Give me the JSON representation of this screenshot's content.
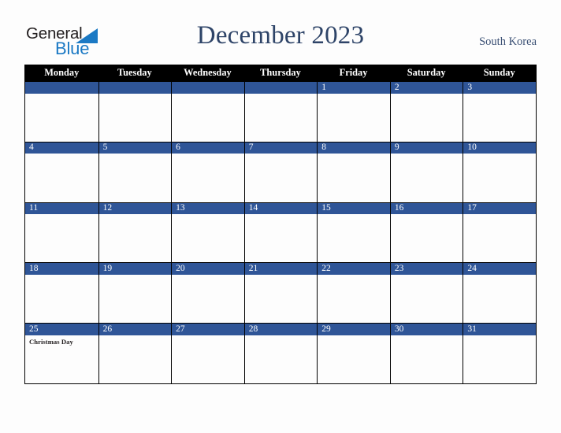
{
  "brand": {
    "word_primary": "General",
    "word_secondary": "Blue",
    "primary_color": "#231f20",
    "secondary_color": "#1b79c4"
  },
  "header": {
    "title": "December 2023",
    "region": "South Korea",
    "title_color": "#2e4468",
    "region_color": "#3c5175"
  },
  "calendar": {
    "accent_color": "#2f5597",
    "header_background": "#000000",
    "weekday_headers": [
      "Monday",
      "Tuesday",
      "Wednesday",
      "Thursday",
      "Friday",
      "Saturday",
      "Sunday"
    ],
    "weeks": [
      [
        {
          "date": "",
          "events": []
        },
        {
          "date": "",
          "events": []
        },
        {
          "date": "",
          "events": []
        },
        {
          "date": "",
          "events": []
        },
        {
          "date": "1",
          "events": []
        },
        {
          "date": "2",
          "events": []
        },
        {
          "date": "3",
          "events": []
        }
      ],
      [
        {
          "date": "4",
          "events": []
        },
        {
          "date": "5",
          "events": []
        },
        {
          "date": "6",
          "events": []
        },
        {
          "date": "7",
          "events": []
        },
        {
          "date": "8",
          "events": []
        },
        {
          "date": "9",
          "events": []
        },
        {
          "date": "10",
          "events": []
        }
      ],
      [
        {
          "date": "11",
          "events": []
        },
        {
          "date": "12",
          "events": []
        },
        {
          "date": "13",
          "events": []
        },
        {
          "date": "14",
          "events": []
        },
        {
          "date": "15",
          "events": []
        },
        {
          "date": "16",
          "events": []
        },
        {
          "date": "17",
          "events": []
        }
      ],
      [
        {
          "date": "18",
          "events": []
        },
        {
          "date": "19",
          "events": []
        },
        {
          "date": "20",
          "events": []
        },
        {
          "date": "21",
          "events": []
        },
        {
          "date": "22",
          "events": []
        },
        {
          "date": "23",
          "events": []
        },
        {
          "date": "24",
          "events": []
        }
      ],
      [
        {
          "date": "25",
          "events": [
            "Christmas Day"
          ]
        },
        {
          "date": "26",
          "events": []
        },
        {
          "date": "27",
          "events": []
        },
        {
          "date": "28",
          "events": []
        },
        {
          "date": "29",
          "events": []
        },
        {
          "date": "30",
          "events": []
        },
        {
          "date": "31",
          "events": []
        }
      ]
    ]
  }
}
